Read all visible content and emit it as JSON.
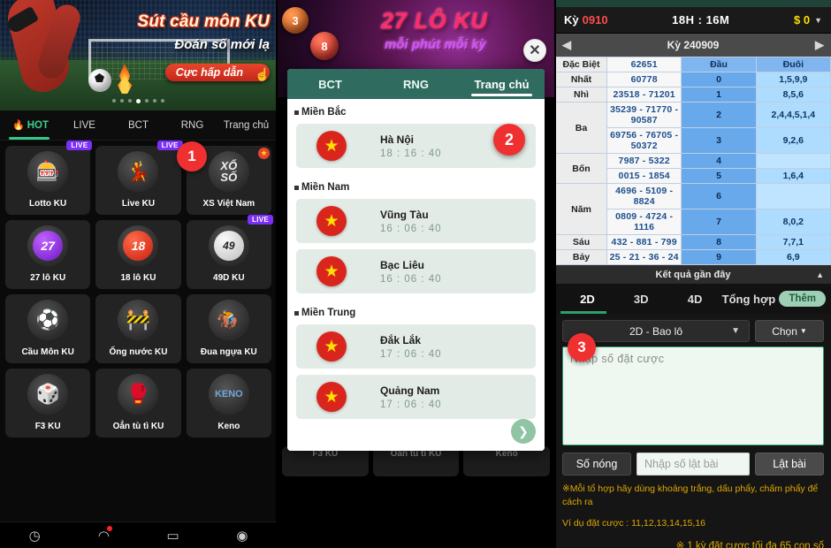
{
  "panel1": {
    "banner": {
      "title": "Sút cầu môn KU",
      "subtitle": "Đoán số mới lạ",
      "cta": "Cực hấp dẫn",
      "hand_icon": "pointer-hand-icon",
      "dots_count": 7,
      "active_dot": 3
    },
    "tabs": [
      {
        "label": "HOT",
        "icon": "flame-icon",
        "active": true
      },
      {
        "label": "LIVE",
        "active": false
      },
      {
        "label": "BCT",
        "active": false
      },
      {
        "label": "RNG",
        "active": false
      },
      {
        "label": "Trang chủ",
        "active": false
      }
    ],
    "games": [
      {
        "name": "Lotto KU",
        "badge": "LIVE",
        "icon": "lotto-balls-icon",
        "glyph": "🎰"
      },
      {
        "name": "Live KU",
        "badge": "LIVE",
        "icon": "live-dealer-icon",
        "glyph": "💃"
      },
      {
        "name": "XS Việt Nam",
        "badge": "STAR",
        "icon": "xoso-icon",
        "glyph": "XỔ SỐ"
      },
      {
        "name": "27 lô KU",
        "badge": "",
        "icon": "ball-27-icon",
        "glyph": "27"
      },
      {
        "name": "18 lô KU",
        "badge": "",
        "icon": "ball-18-icon",
        "glyph": "18"
      },
      {
        "name": "49D KU",
        "badge": "LIVE",
        "icon": "ball-49-icon",
        "glyph": "49"
      },
      {
        "name": "Cầu Môn KU",
        "badge": "",
        "icon": "soccer-ball-icon",
        "glyph": "⚽"
      },
      {
        "name": "Ống nước KU",
        "badge": "",
        "icon": "pipe-icon",
        "glyph": "🚧"
      },
      {
        "name": "Đua ngựa KU",
        "badge": "",
        "icon": "horse-racing-icon",
        "glyph": "🏇"
      },
      {
        "name": "F3 KU",
        "badge": "",
        "icon": "dice-icon",
        "glyph": "🎲"
      },
      {
        "name": "Oẳn tù tì KU",
        "badge": "",
        "icon": "rps-gloves-icon",
        "glyph": "🥊"
      },
      {
        "name": "Keno",
        "badge": "",
        "icon": "keno-icon",
        "glyph": "KENO"
      }
    ],
    "bottom_nav": [
      {
        "icon": "gift-icon",
        "glyph": "◷"
      },
      {
        "icon": "bell-icon",
        "glyph": "◠",
        "dot": true
      },
      {
        "icon": "message-icon",
        "glyph": "▭"
      },
      {
        "icon": "settings-icon",
        "glyph": "◉"
      }
    ],
    "badge_1": "1"
  },
  "panel2": {
    "banner": {
      "title": "27 LÔ KU",
      "subtitle": "mỗi phút mỗi kỳ",
      "ball_left": "3",
      "ball_right": "8",
      "close_icon": "close-circle-icon"
    },
    "tabs": [
      {
        "label": "BCT",
        "active": false
      },
      {
        "label": "RNG",
        "active": false
      },
      {
        "label": "Trang chủ",
        "active": true
      }
    ],
    "sections": [
      {
        "region": "Miền Bắc",
        "rows": [
          {
            "city": "Hà Nội",
            "time": "18 : 16 : 40",
            "badge": "2"
          }
        ]
      },
      {
        "region": "Miền Nam",
        "rows": [
          {
            "city": "Vũng Tàu",
            "time": "16 : 06 : 40",
            "badge": ""
          },
          {
            "city": "Bạc Liêu",
            "time": "16 : 06 : 40",
            "badge": ""
          }
        ]
      },
      {
        "region": "Miền Trung",
        "rows": [
          {
            "city": "Đắk Lắk",
            "time": "17 : 06 : 40",
            "badge": ""
          },
          {
            "city": "Quảng Nam",
            "time": "17 : 06 : 40",
            "badge": ""
          }
        ]
      }
    ],
    "scroll_down_icon": "chevron-down-icon",
    "behind_cards": [
      "F3 KU",
      "Oẳn tù tì KU",
      "Keno"
    ]
  },
  "panel3": {
    "header": {
      "ky_label": "Kỳ",
      "ky_value": "0910",
      "clock": "18H : 16M",
      "money": "$ 0",
      "caret_icon": "caret-down-icon"
    },
    "nav": {
      "prev_icon": "triangle-left-icon",
      "title": "Kỳ 240909",
      "next_icon": "triangle-right-icon"
    },
    "results": {
      "headers": {
        "dau": "Đầu",
        "duoi": "Đuôi"
      },
      "prizes": [
        {
          "label": "Đặc Biệt",
          "values": [
            "62651"
          ]
        },
        {
          "label": "Nhất",
          "values": [
            "60778"
          ]
        },
        {
          "label": "Nhì",
          "values": [
            "23518 - 71201"
          ]
        },
        {
          "label": "Ba",
          "values": [
            "35239 - 71770 - 90587",
            "69756 - 76705 - 50372"
          ]
        },
        {
          "label": "Bốn",
          "values": [
            "7987 - 5322",
            "0015 - 1854"
          ]
        },
        {
          "label": "Năm",
          "values": [
            "4696 - 5109 - 8824",
            "0809 - 4724 - 1116"
          ]
        },
        {
          "label": "Sáu",
          "values": [
            "432 - 881 - 799"
          ]
        },
        {
          "label": "Bảy",
          "values": [
            "25 - 21 - 36 - 24"
          ]
        }
      ],
      "dau_duoi": [
        {
          "dau": "0",
          "duoi": "1,5,9,9"
        },
        {
          "dau": "1",
          "duoi": "8,5,6"
        },
        {
          "dau": "2",
          "duoi": "2,4,4,5,1,4"
        },
        {
          "dau": "3",
          "duoi": "9,2,6"
        },
        {
          "dau": "4",
          "duoi": ""
        },
        {
          "dau": "5",
          "duoi": "1,6,4"
        },
        {
          "dau": "6",
          "duoi": ""
        },
        {
          "dau": "7",
          "duoi": "8,0,2"
        },
        {
          "dau": "8",
          "duoi": "7,7,1"
        },
        {
          "dau": "9",
          "duoi": "6,9"
        }
      ]
    },
    "recent": {
      "label": "Kết quả gần đây",
      "collapse_icon": "chevron-up-icon"
    },
    "bet_tabs": [
      {
        "label": "2D",
        "active": true
      },
      {
        "label": "3D",
        "active": false
      },
      {
        "label": "4D",
        "active": false
      },
      {
        "label": "Tổng hợp",
        "active": false
      }
    ],
    "more_button": "Thêm",
    "select": {
      "value": "2D - Bao lô",
      "chevron_icon": "chevron-down-icon"
    },
    "chon_button": "Chọn",
    "bet_textarea": {
      "placeholder": "Nhập số đặt cược",
      "value": ""
    },
    "hot_button": "Số nóng",
    "flip_input": {
      "placeholder": "Nhập số lật bài",
      "value": ""
    },
    "flip_button": "Lật bài",
    "notes": [
      "※Mỗi tổ hợp hãy dùng khoảng trắng, dấu phẩy, chấm phẩy để cách ra",
      "Ví dụ đặt cược : 11,12,13,14,15,16",
      "※ 1 kỳ đặt cược tối đa 65 con số"
    ],
    "badge_3": "3"
  },
  "colors": {
    "accent_green": "#2f9e6e",
    "sheet_header": "#2f6b5f",
    "badge_red": "#f03030",
    "note_yellow": "#e0a800",
    "table_blue": "#addcff"
  }
}
